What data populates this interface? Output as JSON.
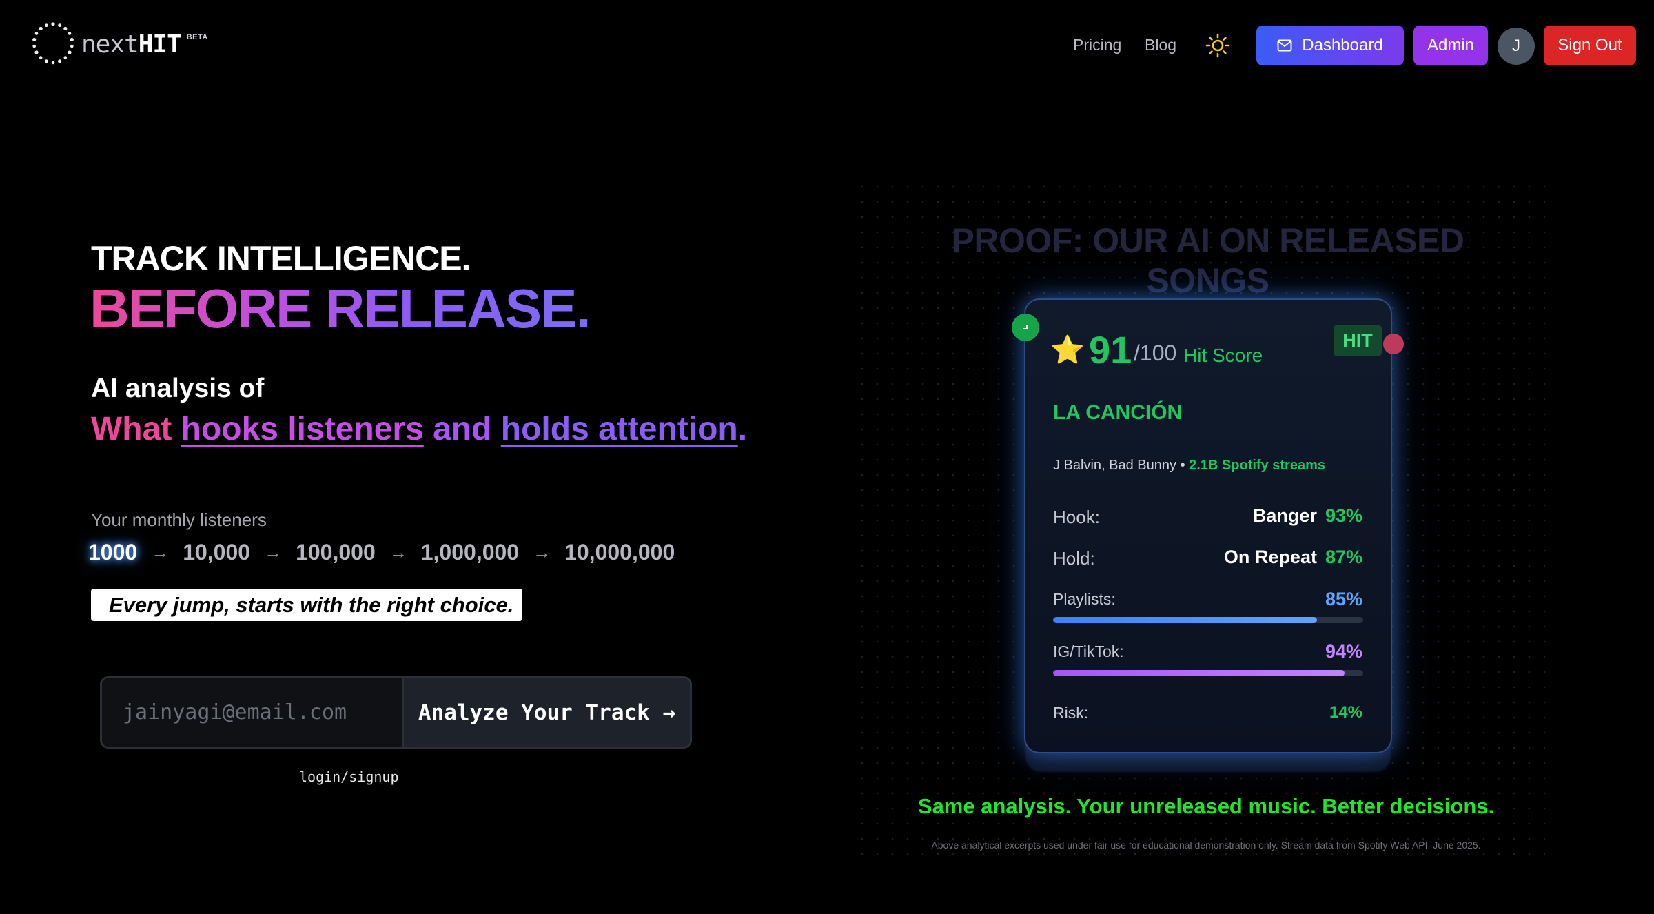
{
  "brand": {
    "name_part1": "next",
    "name_part2": "HIT",
    "badge": "BETA"
  },
  "nav": {
    "pricing": "Pricing",
    "blog": "Blog",
    "theme_icon": "sun-icon",
    "dashboard": "Dashboard",
    "dashboard_icon": "mail-icon",
    "admin": "Admin",
    "avatar_initial": "J",
    "sign_out": "Sign Out"
  },
  "hero": {
    "line1": "TRACK INTELLIGENCE.",
    "line2": "BEFORE RELEASE.",
    "sub1": "AI analysis of",
    "sub2_a": "What ",
    "sub2_b": "hooks listeners",
    "sub2_c": " and ",
    "sub2_d": "holds attention",
    "sub2_e": ".",
    "listeners_label": "Your monthly listeners",
    "listener_steps": [
      "1000",
      "10,000",
      "100,000",
      "1,000,000",
      "10,000,000"
    ],
    "arrow": "→",
    "tagline": "Every jump, starts with the right choice.",
    "email_placeholder": "jainyagi@email.com",
    "cta": "Analyze Your Track →",
    "login": "login/signup"
  },
  "proof": {
    "title": "PROOF: OUR AI ON RELEASED SONGS",
    "star": "⭐",
    "score": "91",
    "score_max": "/100",
    "score_label": "Hit Score",
    "badge": "HIT",
    "song_title": "LA CANCIÓN",
    "artists": "J Balvin, Bad Bunny",
    "separator": "•",
    "streams": "2.1B Spotify streams",
    "hook_label": "Hook:",
    "hook_word": "Banger",
    "hook_pct": "93%",
    "hold_label": "Hold:",
    "hold_word": "On Repeat",
    "hold_pct": "87%",
    "playlists_label": "Playlists:",
    "playlists_pct": "85%",
    "playlists_value": 0.85,
    "ig_label": "IG/TikTok:",
    "ig_pct": "94%",
    "ig_value": 0.94,
    "risk_label": "Risk:",
    "risk_pct": "14%",
    "cta": "Same analysis. Your unreleased music. Better decisions.",
    "disclaimer": "Above analytical excerpts used under fair use for educational demonstration only. Stream data from Spotify Web API, June 2025."
  },
  "colors": {
    "accent_green": "#22c55e",
    "accent_blue": "#3b82f6",
    "accent_purple": "#a855f7",
    "signout_red": "#dc2626"
  }
}
